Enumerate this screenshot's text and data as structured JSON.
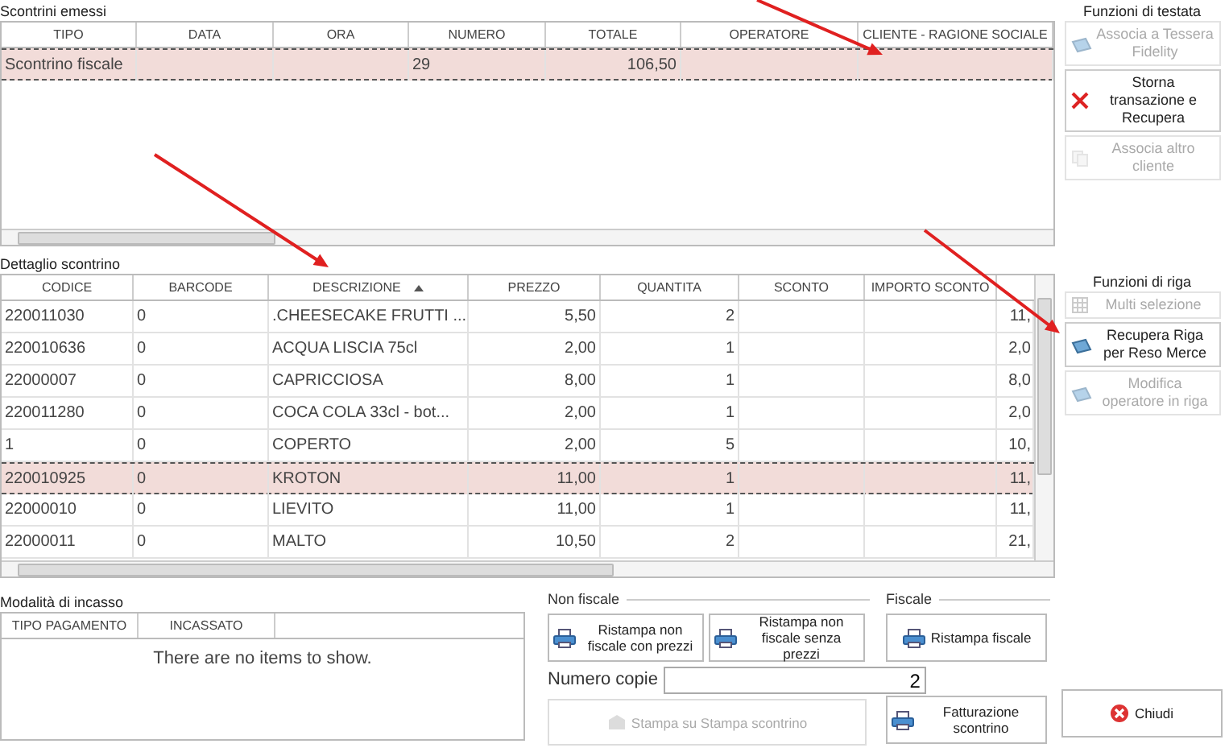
{
  "receipts": {
    "title": "Scontrini emessi",
    "columns": [
      {
        "label": "TIPO"
      },
      {
        "label": "DATA"
      },
      {
        "label": "ORA"
      },
      {
        "label": "NUMERO"
      },
      {
        "label": "TOTALE"
      },
      {
        "label": "OPERATORE"
      },
      {
        "label": "CLIENTE - RAGIONE SOCIALE"
      }
    ],
    "rows": [
      {
        "tipo": "Scontrino fiscale",
        "numero": "29",
        "totale": "106,50",
        "selected": true
      }
    ]
  },
  "detail": {
    "title": "Dettaglio scontrino",
    "columns": [
      {
        "label": "CODICE",
        "sorted": false
      },
      {
        "label": "BARCODE",
        "sorted": false
      },
      {
        "label": "DESCRIZIONE",
        "sorted": true
      },
      {
        "label": "PREZZO",
        "sorted": false
      },
      {
        "label": "QUANTITA",
        "sorted": false
      },
      {
        "label": "SCONTO",
        "sorted": false
      },
      {
        "label": "IMPORTO SCONTO",
        "sorted": false
      }
    ],
    "rows": [
      {
        "codice": "220011030",
        "barcode": "0",
        "descrizione": ".CHEESECAKE FRUTTI ...",
        "prezzo": "5,50",
        "quantita": "2",
        "column_8": "11,",
        "selected": false
      },
      {
        "codice": "220010636",
        "barcode": "0",
        "descrizione": "ACQUA LISCIA 75cl",
        "prezzo": "2,00",
        "quantita": "1",
        "column_8": "2,0",
        "selected": false
      },
      {
        "codice": "22000007",
        "barcode": "0",
        "descrizione": "CAPRICCIOSA",
        "prezzo": "8,00",
        "quantita": "1",
        "column_8": "8,0",
        "selected": false
      },
      {
        "codice": "220011280",
        "barcode": "0",
        "descrizione": "COCA COLA 33cl - bot...",
        "prezzo": "2,00",
        "quantita": "1",
        "column_8": "2,0",
        "selected": false
      },
      {
        "codice": "1",
        "barcode": "0",
        "descrizione": "COPERTO",
        "prezzo": "2,00",
        "quantita": "5",
        "column_8": "10,",
        "selected": false
      },
      {
        "codice": "220010925",
        "barcode": "0",
        "descrizione": "KROTON",
        "prezzo": "11,00",
        "quantita": "1",
        "column_8": "11,",
        "selected": true
      },
      {
        "codice": "22000010",
        "barcode": "0",
        "descrizione": "LIEVITO",
        "prezzo": "11,00",
        "quantita": "1",
        "column_8": "11,",
        "selected": false
      },
      {
        "codice": "22000011",
        "barcode": "0",
        "descrizione": "MALTO",
        "prezzo": "10,50",
        "quantita": "2",
        "column_8": "21,",
        "selected": false
      }
    ]
  },
  "header_functions": {
    "title": "Funzioni di testata",
    "buttons": [
      {
        "label": "Associa a Tessera Fidelity",
        "kind": "card",
        "disabled": true
      },
      {
        "label": "Storna transazione e Recupera",
        "kind": "cross",
        "disabled": false
      },
      {
        "label": "Associa altro cliente",
        "kind": "copy",
        "disabled": true
      }
    ]
  },
  "row_functions": {
    "title": "Funzioni di riga",
    "buttons": [
      {
        "label": "Multi selezione",
        "kind": "grid",
        "disabled": true
      },
      {
        "label": "Recupera Riga per Reso Merce",
        "kind": "card",
        "disabled": false
      },
      {
        "label": "Modifica operatore in riga",
        "kind": "card",
        "disabled": true
      }
    ]
  },
  "payments": {
    "title": "Modalità di incasso",
    "columns": [
      {
        "label": "TIPO PAGAMENTO"
      },
      {
        "label": "INCASSATO"
      }
    ],
    "empty_message": "There are no items to show."
  },
  "non_fiscal": {
    "title": "Non fiscale",
    "buttons": [
      {
        "label": "Ristampa non fiscale con prezzi",
        "kind": "printer",
        "disabled": false
      },
      {
        "label": "Ristampa non fiscale senza prezzi",
        "kind": "printer",
        "disabled": false
      }
    ],
    "copies_label": "Numero copie",
    "copies_value": "2",
    "print_button": {
      "label": "Stampa su Stampa scontrino",
      "kind": "box",
      "disabled": true
    }
  },
  "fiscal": {
    "title": "Fiscale",
    "buttons": [
      {
        "label": "Ristampa fiscale",
        "kind": "printer",
        "disabled": false
      }
    ]
  },
  "invoice_button": {
    "label": "Fatturazione scontrino",
    "kind": "printer"
  },
  "close_button": {
    "label": "Chiudi",
    "kind": "close"
  }
}
